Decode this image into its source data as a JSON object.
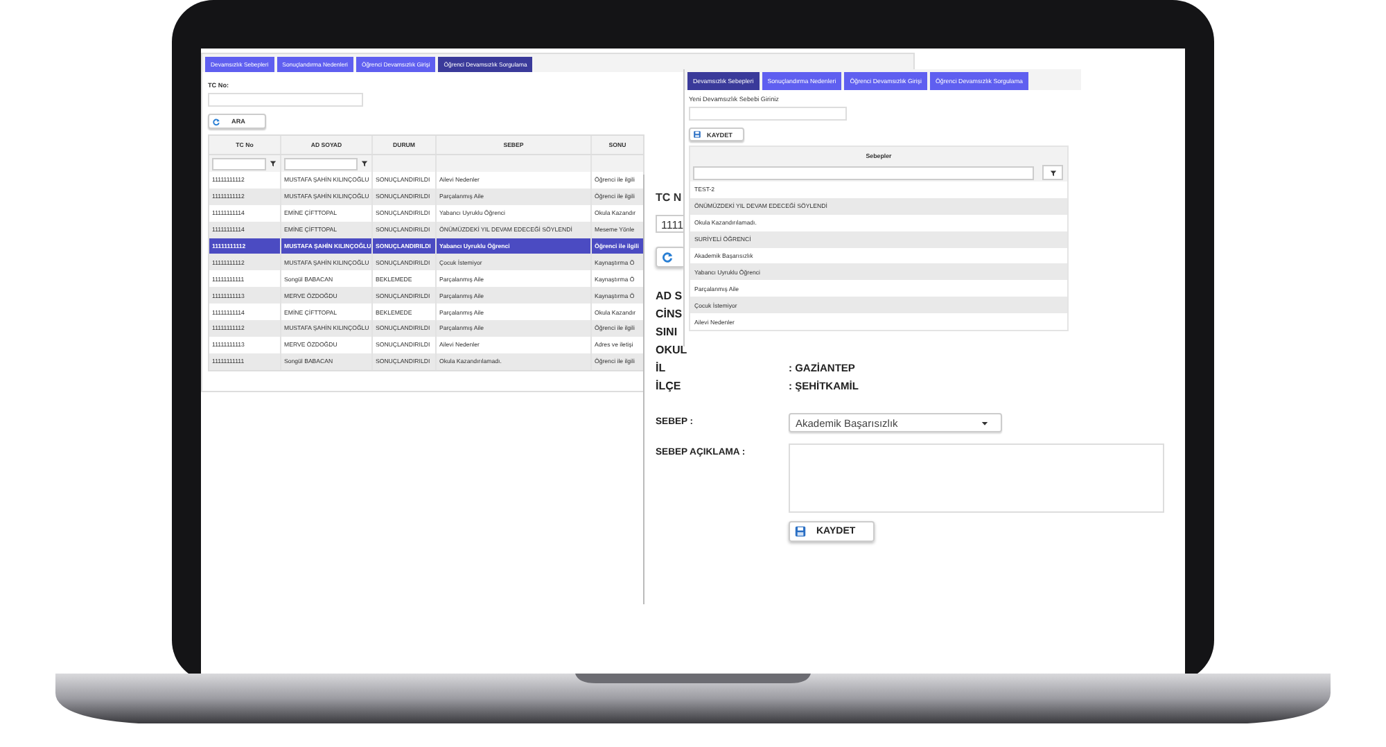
{
  "query_screen": {
    "tabs": [
      {
        "label": "Devamsızlık Sebepleri",
        "selected": false
      },
      {
        "label": "Sonuçlandırma Nedenleri",
        "selected": false
      },
      {
        "label": "Öğrenci Devamsızlık Girişi",
        "selected": false
      },
      {
        "label": "Öğrenci Devamsızlık Sorgulama",
        "selected": true
      }
    ],
    "tc_label": "TC No:",
    "search_button": "ARA",
    "table": {
      "columns": [
        {
          "label": "TC No",
          "filterable": true
        },
        {
          "label": "AD SOYAD",
          "filterable": true
        },
        {
          "label": "DURUM",
          "filterable": false
        },
        {
          "label": "SEBEP",
          "filterable": false
        },
        {
          "label": "SONU",
          "filterable": false
        }
      ],
      "rows": [
        {
          "selected": false,
          "cells": [
            "11111111112",
            "MUSTAFA ŞAHİN KILINÇOĞLU",
            "SONUÇLANDIRILDI",
            "Ailevi Nedenler",
            "Öğrenci ile ilgili"
          ]
        },
        {
          "selected": false,
          "cells": [
            "11111111112",
            "MUSTAFA ŞAHİN KILINÇOĞLU",
            "SONUÇLANDIRILDI",
            "Parçalanmış Aile",
            "Öğrenci ile ilgili"
          ]
        },
        {
          "selected": false,
          "cells": [
            "11111111114",
            "EMİNE ÇİFTTOPAL",
            "SONUÇLANDIRILDI",
            "Yabancı Uyruklu Öğrenci",
            "Okula Kazandır"
          ]
        },
        {
          "selected": false,
          "cells": [
            "11111111114",
            "EMİNE ÇİFTTOPAL",
            "SONUÇLANDIRILDI",
            "ÖNÜMÜZDEKİ YIL DEVAM EDECEĞİ SÖYLENDİ",
            "Meseme Yönle"
          ]
        },
        {
          "selected": true,
          "cells": [
            "11111111112",
            "MUSTAFA ŞAHİN KILINÇOĞLU",
            "SONUÇLANDIRILDI",
            "Yabancı Uyruklu Öğrenci",
            "Öğrenci ile ilgili"
          ]
        },
        {
          "selected": false,
          "cells": [
            "11111111112",
            "MUSTAFA ŞAHİN KILINÇOĞLU",
            "SONUÇLANDIRILDI",
            "Çocuk İstemiyor",
            "Kaynaştırma Ö"
          ]
        },
        {
          "selected": false,
          "cells": [
            "11111111111",
            "Songül BABACAN",
            "BEKLEMEDE",
            "Parçalanmış Aile",
            "Kaynaştırma Ö"
          ]
        },
        {
          "selected": false,
          "cells": [
            "11111111113",
            "MERVE ÖZDOĞDU",
            "SONUÇLANDIRILDI",
            "Parçalanmış Aile",
            "Kaynaştırma Ö"
          ]
        },
        {
          "selected": false,
          "cells": [
            "11111111114",
            "EMİNE ÇİFTTOPAL",
            "BEKLEMEDE",
            "Parçalanmış Aile",
            "Okula Kazandır"
          ]
        },
        {
          "selected": false,
          "cells": [
            "11111111112",
            "MUSTAFA ŞAHİN KILINÇOĞLU",
            "SONUÇLANDIRILDI",
            "Parçalanmış Aile",
            "Öğrenci ile ilgili"
          ]
        },
        {
          "selected": false,
          "cells": [
            "11111111113",
            "MERVE ÖZDOĞDU",
            "SONUÇLANDIRILDI",
            "Ailevi Nedenler",
            "Adres ve iletişi"
          ]
        },
        {
          "selected": false,
          "cells": [
            "11111111111",
            "Songül BABACAN",
            "SONUÇLANDIRILDI",
            "Okula Kazandırılamadı.",
            "Öğrenci ile ilgili"
          ]
        }
      ]
    }
  },
  "detail_screen": {
    "tc_label": "TC N",
    "tc_value": "1111",
    "info": [
      {
        "label": "AD S"
      },
      {
        "label": "CİNS"
      },
      {
        "label": "SINI"
      },
      {
        "label": "OKUL"
      },
      {
        "label": "İL",
        "value": ": GAZİANTEP"
      },
      {
        "label": "İLÇE",
        "value": ": ŞEHİTKAMİL"
      }
    ],
    "sebep_label": "SEBEP :",
    "sebep_value": "Akademik Başarısızlık",
    "aciklama_label": "SEBEP AÇIKLAMA :",
    "save_button": "KAYDET"
  },
  "reasons_screen": {
    "tabs": [
      {
        "label": "Devamsızlık Sebepleri",
        "selected": true
      },
      {
        "label": "Sonuçlandırma Nedenleri",
        "selected": false
      },
      {
        "label": "Öğrenci Devamsızlık Girişi",
        "selected": false
      },
      {
        "label": "Öğrenci Devamsızlık Sorgulama",
        "selected": false
      }
    ],
    "input_label": "Yeni Devamsızlık Sebebi Giriniz",
    "save_button": "KAYDET",
    "table": {
      "column": "Sebepler",
      "rows": [
        "TEST-2",
        "ÖNÜMÜZDEKİ YIL DEVAM EDECEĞİ SÖYLENDİ",
        "Okula Kazandırılamadı.",
        "SURİYELİ ÖĞRENCİ",
        "Akademik Başarısızlık",
        "Yabancı Uyruklu Öğrenci",
        "Parçalanmış Aile",
        "Çocuk İstemiyor",
        "Ailevi Nedenler"
      ]
    }
  }
}
